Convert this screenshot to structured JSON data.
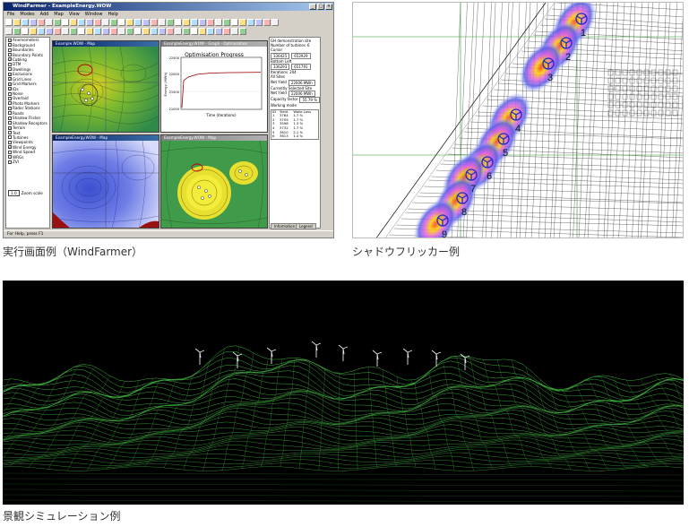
{
  "captions": {
    "windfarmer": "実行画面例（WindFarmer）",
    "shadow_flicker": "シャドウフリッカー例",
    "landscape": "景観シミュレーション例"
  },
  "windfarmer": {
    "title": "WindFarmer - ExampleEnergy.WOW",
    "menus": [
      "File",
      "Modes",
      "Add",
      "Map",
      "View",
      "Window",
      "Help"
    ],
    "layers": [
      {
        "label": "Anemometers",
        "checked": true
      },
      {
        "label": "Background",
        "checked": false
      },
      {
        "label": "Boundaries",
        "checked": false
      },
      {
        "label": "Boundary Points",
        "checked": false
      },
      {
        "label": "Cabling",
        "checked": true
      },
      {
        "label": "DTM",
        "checked": false
      },
      {
        "label": "Dwellings",
        "checked": false
      },
      {
        "label": "Exclusions",
        "checked": true
      },
      {
        "label": "Grid Lines",
        "checked": true
      },
      {
        "label": "Grid Markers",
        "checked": true
      },
      {
        "label": "IDs",
        "checked": true
      },
      {
        "label": "Noise",
        "checked": false
      },
      {
        "label": "Overlaid",
        "checked": false
      },
      {
        "label": "Photo Markers",
        "checked": false
      },
      {
        "label": "Radar Stations",
        "checked": false
      },
      {
        "label": "Roads",
        "checked": false
      },
      {
        "label": "Shadow Flicker",
        "checked": false
      },
      {
        "label": "Shadow Receptors",
        "checked": false
      },
      {
        "label": "Terrain",
        "checked": true
      },
      {
        "label": "Text",
        "checked": false
      },
      {
        "label": "Turbines",
        "checked": false
      },
      {
        "label": "Viewpoints",
        "checked": false
      },
      {
        "label": "Wind Energy",
        "checked": true
      },
      {
        "label": "Wind Speed",
        "checked": false
      },
      {
        "label": "WRGs",
        "checked": false
      },
      {
        "label": "ZVI",
        "checked": false
      }
    ],
    "zoom_value": "1.0",
    "zoom_label": "Zoom scale",
    "windows": {
      "top_left": "Example.WOW - Map",
      "top_right": "ExampleEnergy.WOW - Graph - Optimisation",
      "bottom_left": "ExampleEnergy.WOW - Map",
      "bottom_right": "ExampleEnergy.WOW - Map"
    },
    "graph": {
      "title": "Optimisation Progress",
      "ylabel": "Energy (MWh)",
      "xlabel": "Time (iterations)",
      "yticks": [
        "22500",
        "22000",
        "21500",
        "21000"
      ]
    },
    "info": {
      "header": "GH demonstration site",
      "turbines_label": "Number of turbines",
      "turbines_value": "6",
      "cursor_label": "Cursor",
      "cursor_x": "336425",
      "cursor_y": "652929",
      "bottom_left_label": "Bottom Left",
      "bottom_left_x": "336293",
      "bottom_left_y": "651791",
      "iterations_label": "Iterations",
      "iterations_value": "204",
      "all_sites_label": "All Sites",
      "net_yield_label": "Net Yield",
      "net_yield_value": "22006 MWh",
      "selected_label": "Currently Selected Site",
      "selected_yield_label": "Net Yield",
      "selected_yield_value": "22006 MWh",
      "capacity_label": "Capacity factor",
      "capacity_value": "55.79 %",
      "mode_label": "Working mode",
      "table_headers": [
        "ID",
        "Yield",
        "Wake Loss"
      ],
      "table_rows": [
        [
          "1",
          "3764",
          "1.7 %"
        ],
        [
          "2",
          "3709",
          "1.7 %"
        ],
        [
          "3",
          "3598",
          "1.3 %"
        ],
        [
          "4",
          "3732",
          "1.7 %"
        ],
        [
          "5",
          "3610",
          "2.1 %"
        ],
        [
          "6",
          "3613",
          "1.4 %"
        ]
      ],
      "tab_information": "Information",
      "tab_legend": "Legend"
    },
    "status": "For Help, press F1"
  },
  "shadow_map": {
    "turbine_labels": [
      "1",
      "2",
      "3",
      "4",
      "5",
      "6",
      "7",
      "8",
      "9"
    ]
  },
  "colors": {
    "title_blue": "#0a246a",
    "window_grey": "#d4d0c8",
    "wireframe_green": "#3fae3f",
    "shadow_blue": "#3a4fd8",
    "shadow_yellow": "#f0e000"
  }
}
